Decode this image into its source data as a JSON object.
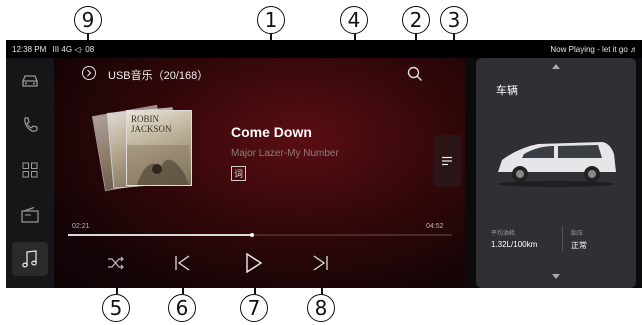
{
  "callouts": [
    "1",
    "2",
    "3",
    "4",
    "5",
    "6",
    "7",
    "8",
    "9"
  ],
  "status_bar": {
    "time": "12:38 PM",
    "indicators": "III 4G ◁· 08",
    "now_playing": "Now Playing - let it go ♬"
  },
  "sidebar": {
    "items": [
      {
        "icon": "car-icon"
      },
      {
        "icon": "phone-icon"
      },
      {
        "icon": "apps-grid-icon"
      },
      {
        "icon": "radio-icon"
      },
      {
        "icon": "music-note-icon",
        "active": true
      }
    ]
  },
  "player": {
    "source_title": "USB音乐（20/168）",
    "album_text": "ROBIN JACKSON",
    "song_title": "Come Down",
    "artist": "Major Lazer-My Number",
    "lyrics_label": "词",
    "time_elapsed": "02:21",
    "time_total": "04:52",
    "progress": 0.48,
    "controls": [
      "shuffle-icon",
      "previous-icon",
      "play-icon",
      "next-icon"
    ]
  },
  "vehicle": {
    "title": "车辆",
    "fuel_label": "平均油耗",
    "fuel_value": "1.32L/100km",
    "tire_label": "胎压",
    "tire_value": "正常"
  },
  "colors": {
    "accent_red": "#5a0e12",
    "background": "#0b0b0d",
    "card": "#303034"
  }
}
